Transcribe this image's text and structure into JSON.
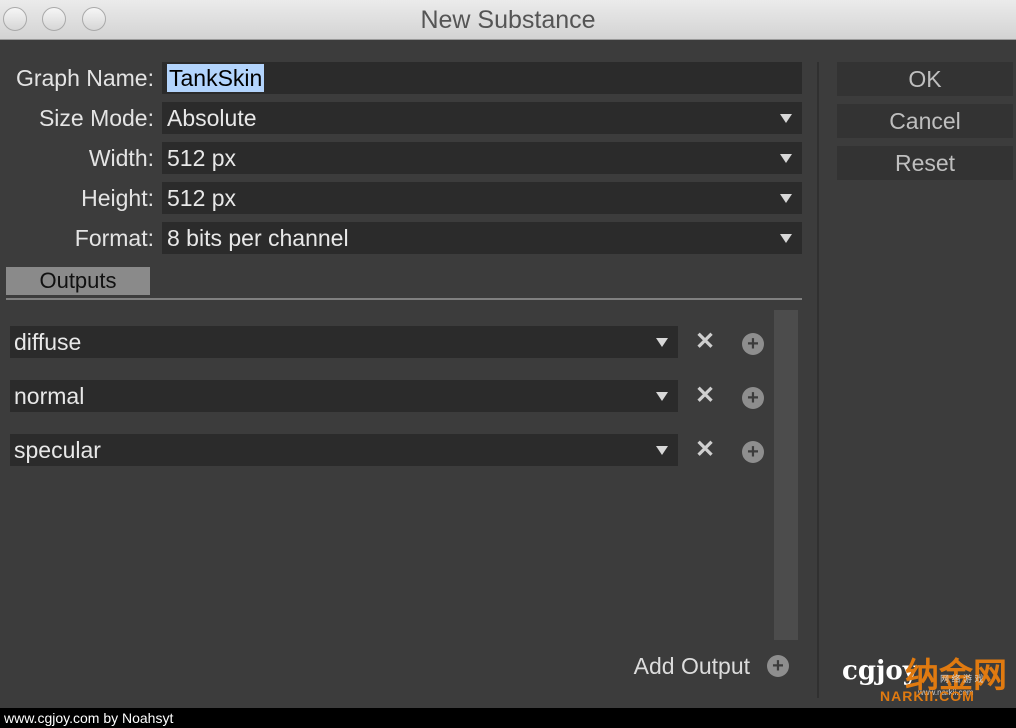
{
  "window": {
    "title": "New Substance"
  },
  "form": {
    "graph_name_label": "Graph Name:",
    "graph_name_value": "TankSkin",
    "size_mode_label": "Size Mode:",
    "size_mode_value": "Absolute",
    "width_label": "Width:",
    "width_value": "512 px",
    "height_label": "Height:",
    "height_value": "512 px",
    "format_label": "Format:",
    "format_value": "8 bits per channel"
  },
  "outputs": {
    "tab_label": "Outputs",
    "items": [
      {
        "value": "diffuse"
      },
      {
        "value": "normal"
      },
      {
        "value": "specular"
      }
    ],
    "add_label": "Add Output"
  },
  "buttons": {
    "ok": "OK",
    "cancel": "Cancel",
    "reset": "Reset"
  },
  "caption": "www.cgjoy.com by Noahsyt",
  "watermark": {
    "logo_text": "cgjoy",
    "brand_text": "纳金网",
    "url_text": "NARKII.COM",
    "small_text": "网 络 游 戏",
    "small_text2": "www.narkii.com"
  },
  "colors": {
    "accent_highlight": "#b3d4fc",
    "panel": "#3c3c3c",
    "field": "#2b2b2b"
  }
}
